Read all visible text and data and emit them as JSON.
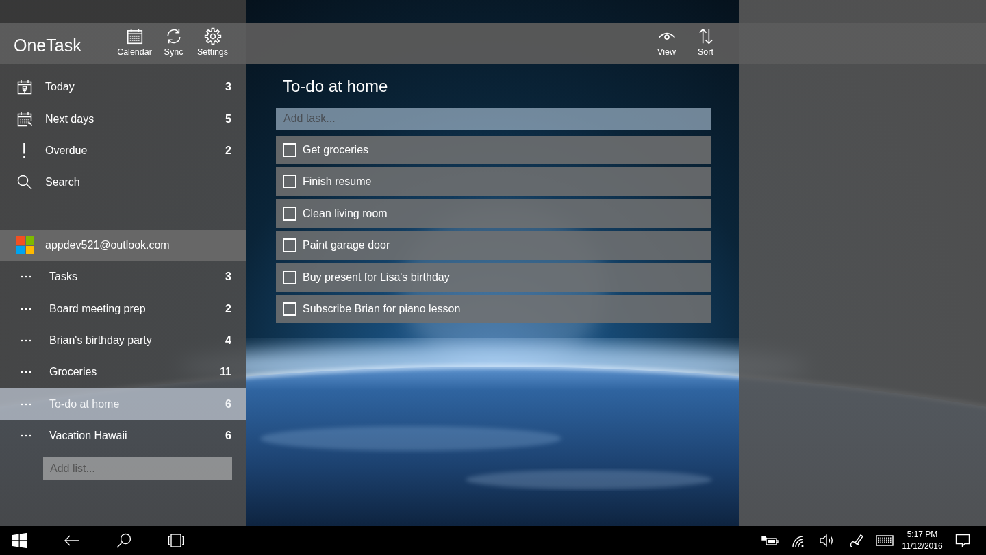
{
  "app_bar": {
    "title": "OneTask",
    "buttons": [
      {
        "label": "Calendar",
        "kind": "calendar"
      },
      {
        "label": "Sync",
        "kind": "sync"
      },
      {
        "label": "Settings",
        "kind": "settings"
      }
    ]
  },
  "nav": [
    {
      "label": "Today",
      "count": "3",
      "kind": "today"
    },
    {
      "label": "Next days",
      "count": "5",
      "kind": "upcoming"
    },
    {
      "label": "Overdue",
      "count": "2",
      "kind": "overdue"
    },
    {
      "label": "Search",
      "kind": "search"
    }
  ],
  "account": {
    "email": "appdev521@outlook.com"
  },
  "lists": [
    {
      "name": "Tasks",
      "count": "3",
      "selected": false
    },
    {
      "name": "Board meeting prep",
      "count": "2",
      "selected": false
    },
    {
      "name": "Brian's birthday party",
      "count": "4",
      "selected": false
    },
    {
      "name": "Groceries",
      "count": "11",
      "selected": false
    },
    {
      "name": "To-do at home",
      "count": "6",
      "selected": true
    },
    {
      "name": "Vacation Hawaii",
      "count": "6",
      "selected": false
    }
  ],
  "add_list": {
    "placeholder": "Add list..."
  },
  "toolbar": {
    "buttons": [
      {
        "label": "View",
        "kind": "view"
      },
      {
        "label": "Sort",
        "kind": "sort"
      }
    ]
  },
  "list_view": {
    "title": "To-do at home",
    "add_task": {
      "placeholder": "Add task..."
    },
    "tasks": [
      {
        "label": "Get groceries",
        "checked": false
      },
      {
        "label": "Finish resume",
        "checked": false
      },
      {
        "label": "Clean living room",
        "checked": false
      },
      {
        "label": "Paint garage door",
        "checked": false
      },
      {
        "label": "Buy present for Lisa's birthday",
        "checked": false
      },
      {
        "label": "Subscribe Brian for piano lesson",
        "checked": false
      }
    ]
  },
  "taskbar": {
    "time": "5:17 PM",
    "date": "11/12/2016"
  }
}
